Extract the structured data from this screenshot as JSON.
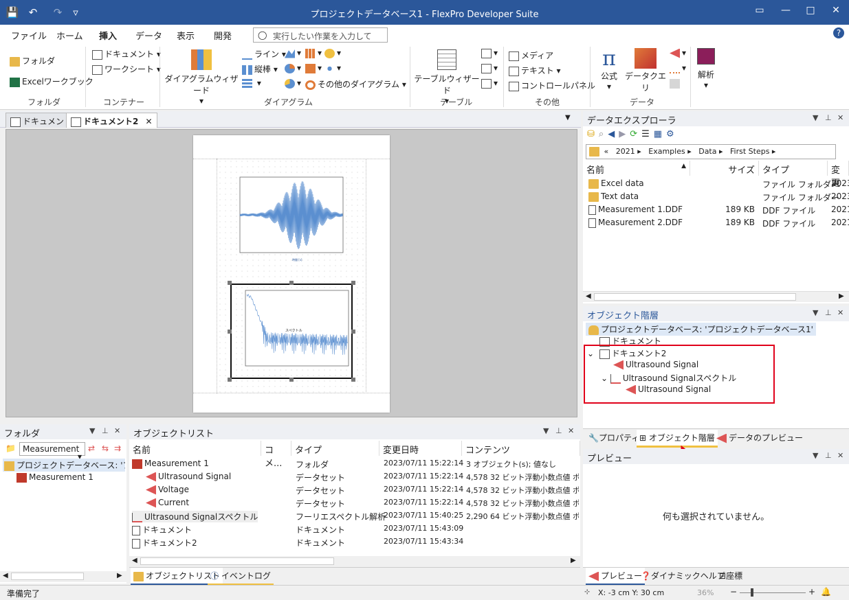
{
  "window": {
    "title": "プロジェクトデータベース1 - FlexPro Developer Suite"
  },
  "menu": [
    "ファイル",
    "ホーム",
    "挿入",
    "データ",
    "表示",
    "開発"
  ],
  "menu_active_index": 2,
  "search": {
    "placeholder": "実行したい作業を入力してく..."
  },
  "ribbon": {
    "folder_group": {
      "folder": "フォルダ",
      "excel": "Excelワークブック",
      "label": "フォルダ"
    },
    "container_group": {
      "document": "ドキュメント",
      "worksheet": "ワークシート",
      "label": "コンテナー"
    },
    "diagram_group": {
      "wizard": "ダイアグラムウィザード",
      "line": "ライン",
      "bar": "縦棒",
      "other": "その他のダイアグラム",
      "label": "ダイアグラム"
    },
    "table_group": {
      "wizard": "テーブルウィザード",
      "label": "テーブル"
    },
    "other_group": {
      "media": "メディア",
      "text": "テキスト",
      "control": "コントロールパネル",
      "label": "その他"
    },
    "data_group": {
      "formula": "公式",
      "query": "データクエリ",
      "analysis": "解析",
      "label": "データ"
    }
  },
  "doc_tabs": [
    "ドキュメント",
    "ドキュメント2"
  ],
  "chart_annotation": "スペクトル",
  "data_explorer": {
    "title": "データエクスプローラ",
    "breadcrumb": [
      "«",
      "2021",
      "Examples",
      "Data",
      "First Steps"
    ],
    "columns": [
      "名前",
      "サイズ",
      "タイプ",
      "変更"
    ],
    "rows": [
      {
        "name": "Excel data",
        "size": "",
        "type": "ファイル フォルダー",
        "date": "2023",
        "icon": "folder-icon"
      },
      {
        "name": "Text data",
        "size": "",
        "type": "ファイル フォルダー",
        "date": "2023",
        "icon": "folder-icon"
      },
      {
        "name": "Measurement 1.DDF",
        "size": "189 KB",
        "type": "DDF ファイル",
        "date": "2021",
        "icon": "file-icon"
      },
      {
        "name": "Measurement 2.DDF",
        "size": "189 KB",
        "type": "DDF ファイル",
        "date": "2021",
        "icon": "file-icon"
      }
    ]
  },
  "object_hierarchy": {
    "title": "オブジェクト階層",
    "root": "プロジェクトデータベース: 'プロジェクトデータベース1'",
    "doc1": "ドキュメント",
    "doc2": "ドキュメント2",
    "sig1": "Ultrasound Signal",
    "spectrum": "Ultrasound Signalスペクトル",
    "sig2": "Ultrasound Signal"
  },
  "right_tabs": [
    "プロパティ",
    "オブジェクト階層",
    "データのプレビュー"
  ],
  "preview": {
    "title": "プレビュー",
    "empty": "何も選択されていません。"
  },
  "bottom_right_tabs": [
    "プレビュー",
    "ダイナミックヘルプ",
    "座標"
  ],
  "folder_panel": {
    "title": "フォルダ",
    "combo": "Measurement",
    "root": "プロジェクトデータベース: 'プロジェク",
    "child": "Measurement 1"
  },
  "object_list": {
    "title": "オブジェクトリスト",
    "columns": [
      "名前",
      "コメ...",
      "タイプ",
      "変更日時",
      "コンテンツ"
    ],
    "rows": [
      {
        "name": "Measurement 1",
        "type": "フォルダ",
        "date": "2023/07/11 15:22:14",
        "content": "3 オブジェクト(s); 値なし",
        "indent": 0
      },
      {
        "name": "Ultrasound Signal",
        "type": "データセット",
        "date": "2023/07/11 15:22:14",
        "content": "4,578 32 ビット浮動小数点値 ポイ",
        "indent": 1
      },
      {
        "name": "Voltage",
        "type": "データセット",
        "date": "2023/07/11 15:22:14",
        "content": "4,578 32 ビット浮動小数点値 ポイ",
        "indent": 1
      },
      {
        "name": "Current",
        "type": "データセット",
        "date": "2023/07/11 15:22:14",
        "content": "4,578 32 ビット浮動小数点値 ポイ",
        "indent": 1
      },
      {
        "name": "Ultrasound Signalスペクトル",
        "type": "フーリエスペクトル解析",
        "date": "2023/07/11 15:40:25",
        "content": "2,290 64 ビット浮動小数点値 ポイ",
        "indent": 0
      },
      {
        "name": "ドキュメント",
        "type": "ドキュメント",
        "date": "2023/07/11 15:43:09",
        "content": "",
        "indent": 0
      },
      {
        "name": "ドキュメント2",
        "type": "ドキュメント",
        "date": "2023/07/11 15:43:34",
        "content": "",
        "indent": 0
      }
    ]
  },
  "bottom_tabs": [
    "オブジェクトリスト",
    "イベントログ"
  ],
  "status": {
    "left": "準備完了",
    "coords": "X: -3 cm Y: 30 cm",
    "zoom": "36%"
  },
  "colors": {
    "title_bar": "#2b579a",
    "highlight": "#e0001a",
    "signal": "#5b8fd0"
  }
}
